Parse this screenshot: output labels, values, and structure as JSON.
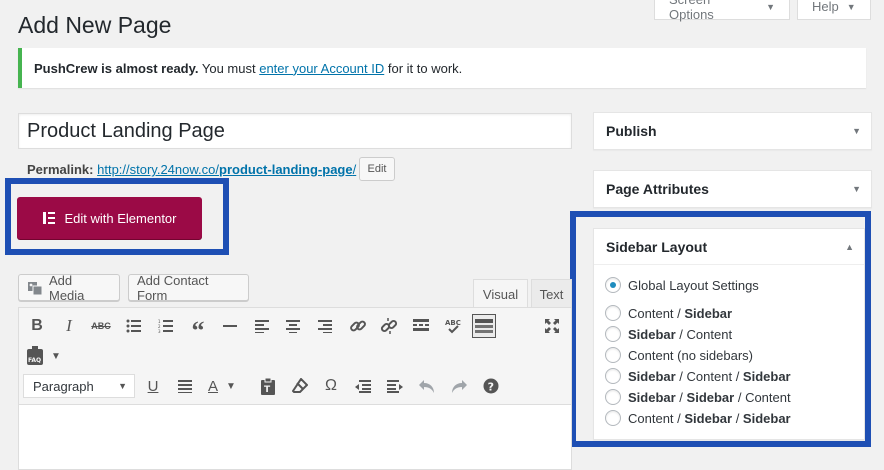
{
  "header": {
    "screen_options_label": "Screen Options",
    "help_label": "Help",
    "page_title": "Add New Page"
  },
  "notice": {
    "strong": "PushCrew is almost ready.",
    "text_before_link": " You must ",
    "link": "enter your Account ID",
    "text_after_link": " for it to work."
  },
  "editor": {
    "title_value": "Product Landing Page",
    "permalink_label": "Permalink:",
    "permalink_base": "http://story.24now.co/",
    "permalink_slug": "product-landing-page",
    "permalink_suffix": "/",
    "permalink_edit": "Edit",
    "elementor_button": "Edit with Elementor",
    "add_media": "Add Media",
    "add_contact_form": "Add Contact Form",
    "tab_visual": "Visual",
    "tab_text": "Text",
    "format_select": "Paragraph",
    "toolbar_row1": [
      "bold-icon",
      "italic-icon",
      "strikethrough-icon",
      "bulleted-list-icon",
      "numbered-list-icon",
      "blockquote-icon",
      "horizontal-line-icon",
      "align-left-icon",
      "align-center-icon",
      "align-right-icon",
      "insert-link-icon",
      "remove-link-icon",
      "read-more-icon",
      "spellcheck-icon",
      "toolbar-toggle-icon",
      "fullscreen-icon"
    ],
    "toolbar_row2": [
      "faq-icon"
    ],
    "toolbar_row3": [
      "underline-icon",
      "justify-icon",
      "text-color-icon",
      "paste-text-icon",
      "clear-formatting-icon",
      "special-character-icon",
      "outdent-icon",
      "indent-icon",
      "undo-icon",
      "redo-icon",
      "help-icon"
    ]
  },
  "sidebar": {
    "publish_title": "Publish",
    "page_attributes_title": "Page Attributes",
    "sidebar_layout_title": "Sidebar Layout",
    "options": [
      {
        "parts": [
          {
            "t": "Global Layout Settings",
            "b": false
          }
        ],
        "checked": true
      },
      {
        "parts": [
          {
            "t": "Content",
            "b": false
          },
          {
            "t": " / ",
            "b": false
          },
          {
            "t": "Sidebar",
            "b": true
          }
        ],
        "checked": false
      },
      {
        "parts": [
          {
            "t": "Sidebar",
            "b": true
          },
          {
            "t": " / ",
            "b": false
          },
          {
            "t": "Content",
            "b": false
          }
        ],
        "checked": false
      },
      {
        "parts": [
          {
            "t": "Content (no sidebars)",
            "b": false
          }
        ],
        "checked": false
      },
      {
        "parts": [
          {
            "t": "Sidebar",
            "b": true
          },
          {
            "t": " / ",
            "b": false
          },
          {
            "t": "Content",
            "b": false
          },
          {
            "t": " / ",
            "b": false
          },
          {
            "t": "Sidebar",
            "b": true
          }
        ],
        "checked": false
      },
      {
        "parts": [
          {
            "t": "Sidebar",
            "b": true
          },
          {
            "t": " / ",
            "b": false
          },
          {
            "t": "Sidebar",
            "b": true
          },
          {
            "t": " / ",
            "b": false
          },
          {
            "t": "Content",
            "b": false
          }
        ],
        "checked": false
      },
      {
        "parts": [
          {
            "t": "Content",
            "b": false
          },
          {
            "t": " / ",
            "b": false
          },
          {
            "t": "Sidebar",
            "b": true
          },
          {
            "t": " / ",
            "b": false
          },
          {
            "t": "Sidebar",
            "b": true
          }
        ],
        "checked": false
      }
    ]
  },
  "colors": {
    "elementor": "#9b0a46",
    "highlight_frame": "#1e4fb4",
    "notice_border": "#46b450",
    "link": "#0073aa"
  }
}
